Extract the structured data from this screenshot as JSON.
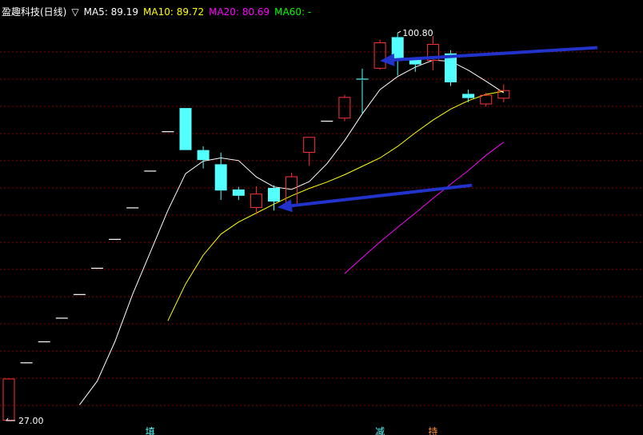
{
  "chart_data": {
    "type": "candlestick",
    "title": "盈趣科技(日线)",
    "legend_marker": "▽",
    "ma_labels": [
      {
        "name": "MA5",
        "value": "89.19",
        "color": "#ffffff"
      },
      {
        "name": "MA10",
        "value": "89.72",
        "color": "#ffff00"
      },
      {
        "name": "MA20",
        "value": "80.69",
        "color": "#ff00ff"
      },
      {
        "name": "MA60",
        "value": "-",
        "color": "#00ff00"
      }
    ],
    "high_label": "100.80",
    "low_label": "27.00",
    "ylim": [
      27.0,
      102.5
    ],
    "colors": {
      "up": "#ff3232",
      "down": "#54ffff",
      "ma5": "#ffffff",
      "ma10": "#ffff00",
      "ma20": "#ff00ff",
      "grid": "#8b0000",
      "arrow": "#2233cc"
    },
    "candles": [
      {
        "o": 27.0,
        "h": 35.0,
        "l": 27.0,
        "c": 35.0
      },
      {
        "o": 38.0,
        "h": 38.0,
        "l": 38.0,
        "c": 38.0
      },
      {
        "o": 42.0,
        "h": 42.0,
        "l": 42.0,
        "c": 42.0
      },
      {
        "o": 46.5,
        "h": 46.5,
        "l": 46.5,
        "c": 46.5
      },
      {
        "o": 51.0,
        "h": 51.0,
        "l": 51.0,
        "c": 51.0
      },
      {
        "o": 56.0,
        "h": 56.0,
        "l": 56.0,
        "c": 56.0
      },
      {
        "o": 61.5,
        "h": 61.5,
        "l": 61.5,
        "c": 61.5
      },
      {
        "o": 67.5,
        "h": 67.5,
        "l": 67.5,
        "c": 67.5
      },
      {
        "o": 74.5,
        "h": 74.5,
        "l": 74.5,
        "c": 74.5
      },
      {
        "o": 82.0,
        "h": 82.0,
        "l": 82.0,
        "c": 82.0
      },
      {
        "o": 86.5,
        "h": 86.5,
        "l": 78.5,
        "c": 78.5
      },
      {
        "o": 78.5,
        "h": 79.2,
        "l": 75.0,
        "c": 76.6
      },
      {
        "o": 75.8,
        "h": 78.0,
        "l": 69.0,
        "c": 70.8
      },
      {
        "o": 71.0,
        "h": 71.5,
        "l": 69.0,
        "c": 69.8
      },
      {
        "o": 67.5,
        "h": 71.6,
        "l": 66.3,
        "c": 70.2
      },
      {
        "o": 71.3,
        "h": 71.8,
        "l": 67.0,
        "c": 68.7
      },
      {
        "o": 67.8,
        "h": 74.2,
        "l": 67.8,
        "c": 73.5
      },
      {
        "o": 78.0,
        "h": 81.0,
        "l": 75.5,
        "c": 81.0
      },
      {
        "o": 84.0,
        "h": 84.0,
        "l": 84.0,
        "c": 84.0
      },
      {
        "o": 84.5,
        "h": 89.0,
        "l": 84.0,
        "c": 88.6
      },
      {
        "o": 92.0,
        "h": 94.0,
        "l": 85.5,
        "c": 91.8
      },
      {
        "o": 94.0,
        "h": 99.5,
        "l": 93.8,
        "c": 99.0
      },
      {
        "o": 100.0,
        "h": 100.8,
        "l": 92.7,
        "c": 95.7
      },
      {
        "o": 95.8,
        "h": 96.1,
        "l": 93.4,
        "c": 94.8
      },
      {
        "o": 95.5,
        "h": 100.2,
        "l": 93.7,
        "c": 98.7
      },
      {
        "o": 96.9,
        "h": 97.5,
        "l": 90.7,
        "c": 91.4
      },
      {
        "o": 89.2,
        "h": 90.0,
        "l": 87.6,
        "c": 88.4
      },
      {
        "o": 87.2,
        "h": 89.4,
        "l": 86.8,
        "c": 89.0
      },
      {
        "o": 88.3,
        "h": 91.0,
        "l": 87.6,
        "c": 89.9
      }
    ],
    "ma5": [
      {
        "i": 4,
        "v": 30.0
      },
      {
        "i": 5,
        "v": 34.5
      },
      {
        "i": 6,
        "v": 42.0
      },
      {
        "i": 7,
        "v": 51.0
      },
      {
        "i": 8,
        "v": 59.0
      },
      {
        "i": 9,
        "v": 67.0
      },
      {
        "i": 10,
        "v": 74.0
      },
      {
        "i": 11,
        "v": 76.4
      },
      {
        "i": 12,
        "v": 77.0
      },
      {
        "i": 13,
        "v": 76.5
      },
      {
        "i": 14,
        "v": 73.4
      },
      {
        "i": 15,
        "v": 71.5
      },
      {
        "i": 16,
        "v": 71.0
      },
      {
        "i": 17,
        "v": 72.5
      },
      {
        "i": 18,
        "v": 75.9
      },
      {
        "i": 19,
        "v": 80.3
      },
      {
        "i": 20,
        "v": 85.4
      },
      {
        "i": 21,
        "v": 90.0
      },
      {
        "i": 22,
        "v": 92.5
      },
      {
        "i": 23,
        "v": 94.3
      },
      {
        "i": 24,
        "v": 95.6
      },
      {
        "i": 25,
        "v": 95.4
      },
      {
        "i": 26,
        "v": 93.7
      },
      {
        "i": 27,
        "v": 91.6
      },
      {
        "i": 28,
        "v": 89.4
      }
    ],
    "ma10": [
      {
        "i": 9,
        "v": 46.0
      },
      {
        "i": 10,
        "v": 53.0
      },
      {
        "i": 11,
        "v": 58.5
      },
      {
        "i": 12,
        "v": 62.5
      },
      {
        "i": 13,
        "v": 64.8
      },
      {
        "i": 14,
        "v": 66.5
      },
      {
        "i": 15,
        "v": 68.2
      },
      {
        "i": 16,
        "v": 69.8
      },
      {
        "i": 17,
        "v": 71.2
      },
      {
        "i": 18,
        "v": 72.4
      },
      {
        "i": 19,
        "v": 73.8
      },
      {
        "i": 20,
        "v": 75.4
      },
      {
        "i": 21,
        "v": 77.0
      },
      {
        "i": 22,
        "v": 79.2
      },
      {
        "i": 23,
        "v": 81.8
      },
      {
        "i": 24,
        "v": 84.2
      },
      {
        "i": 25,
        "v": 86.3
      },
      {
        "i": 26,
        "v": 87.9
      },
      {
        "i": 27,
        "v": 89.1
      },
      {
        "i": 28,
        "v": 89.7
      }
    ],
    "ma20": [
      {
        "i": 19,
        "v": 55.0
      },
      {
        "i": 20,
        "v": 58.0
      },
      {
        "i": 21,
        "v": 61.0
      },
      {
        "i": 22,
        "v": 63.8
      },
      {
        "i": 23,
        "v": 66.5
      },
      {
        "i": 24,
        "v": 69.3
      },
      {
        "i": 25,
        "v": 72.0
      },
      {
        "i": 26,
        "v": 74.6
      },
      {
        "i": 27,
        "v": 77.5
      },
      {
        "i": 28,
        "v": 80.0
      }
    ],
    "arrows": [
      {
        "from": {
          "i": 33.3,
          "v": 98.0
        },
        "to": {
          "i": 21.0,
          "v": 95.5
        }
      },
      {
        "from": {
          "i": 26.2,
          "v": 71.8
        },
        "to": {
          "i": 15.2,
          "v": 67.6
        }
      }
    ],
    "signals": [
      {
        "i": 8,
        "text": "填",
        "color": "#54ffff"
      },
      {
        "i": 21,
        "text": "减",
        "color": "#54ffff"
      },
      {
        "i": 24,
        "text": "持",
        "color": "#ff8c3c"
      }
    ]
  }
}
